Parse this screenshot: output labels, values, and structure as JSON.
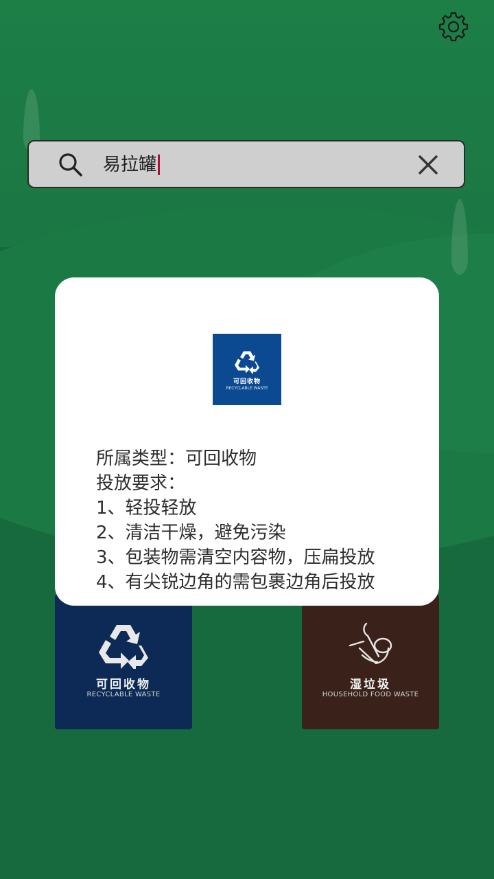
{
  "search": {
    "query": "易拉罐"
  },
  "popup": {
    "badge": {
      "label_cn": "可回收物",
      "label_en": "RECYCLABLE WASTE"
    },
    "category_label": "所属类型：",
    "category_value": "可回收物",
    "rules_title": "投放要求：",
    "rules": [
      "1、轻投轻放",
      "2、清洁干燥，避免污染",
      "3、包装物需清空内容物，压扁投放",
      "4、有尖锐边角的需包裹边角后投放"
    ]
  },
  "bins": [
    {
      "label_cn": "可回收物",
      "label_en": "RECYCLABLE WASTE",
      "color": "#0c2a55",
      "icon": "recycle-icon"
    },
    {
      "label_cn": "湿垃圾",
      "label_en": "HOUSEHOLD FOOD WASTE",
      "color": "#3a221b",
      "icon": "food-waste-icon"
    }
  ],
  "colors": {
    "background": "#1b7a44",
    "search_bg": "#cfcfcf",
    "recycle_blue": "#0b4a91",
    "caret": "#b0103a"
  }
}
